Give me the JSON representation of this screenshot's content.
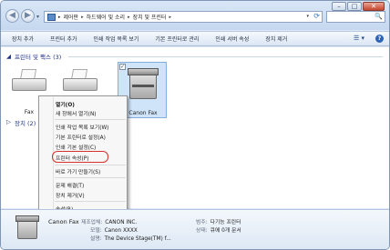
{
  "window": {
    "controls": {
      "minimize": "–",
      "maximize": "□",
      "close": "✕"
    }
  },
  "nav": {
    "back": "◀",
    "forward": "▶",
    "dropdown": "▾"
  },
  "address": {
    "segments": [
      "제어판",
      "하드웨어 및 소리",
      "장치 및 프린터"
    ],
    "separator": "▸",
    "dropdown": "▾",
    "refresh": "⟳"
  },
  "search": {
    "placeholder": "",
    "icon": "🔍"
  },
  "commandbar": {
    "items": [
      "장치 추가",
      "프린터 추가",
      "인쇄 작업 목록 보기",
      "기본 프린터로 관리",
      "인쇄 서버 속성",
      "장치 제거"
    ],
    "view_icon": "☰ ▾",
    "help_icon": "?"
  },
  "groups": {
    "printers": {
      "toggle": "◢",
      "title": "프린터 및 팩스 (3)"
    },
    "devices": {
      "toggle": "▷",
      "title": "장치 (2)"
    }
  },
  "devices": [
    {
      "label": "Fax",
      "icon": "fax-printer-icon"
    },
    {
      "label": "",
      "icon": "printer-icon"
    },
    {
      "label": "Canon Fax",
      "icon": "multifunction-printer-icon",
      "checked": "✓"
    }
  ],
  "context_menu": {
    "items": [
      {
        "label": "열기(O)",
        "bold": true
      },
      {
        "label": "새 창에서 열기(N)"
      },
      {
        "label": "인쇄 작업 목록 보기(W)"
      },
      {
        "label": "기본 프린터로 설정(A)"
      },
      {
        "label": "인쇄 기본 설정(C)"
      },
      {
        "label": "프린터 속성(P)",
        "highlighted": true
      },
      {
        "label": "바로 가기 만들기(S)"
      },
      {
        "label": "문제 해결(T)"
      },
      {
        "label": "장치 제거(V)"
      },
      {
        "label": "속성(R)"
      }
    ],
    "highlight_color": "#d9302a"
  },
  "details": {
    "name": "Canon Fax",
    "manufacturer": {
      "key": "제조업체:",
      "value": "CANON INC."
    },
    "model": {
      "key": "모델:",
      "value": "Canon XXXX"
    },
    "description": {
      "key": "설명:",
      "value": "The Device Stage(TM) f..."
    },
    "category": {
      "key": "범주:",
      "value": "다기능 프린터"
    },
    "status": {
      "key": "상태:",
      "value": "큐에 0개 문서"
    }
  },
  "colors": {
    "frame": "#7f97b5",
    "group_title": "#1e3287",
    "selected_bg": "#cfe4f8"
  }
}
